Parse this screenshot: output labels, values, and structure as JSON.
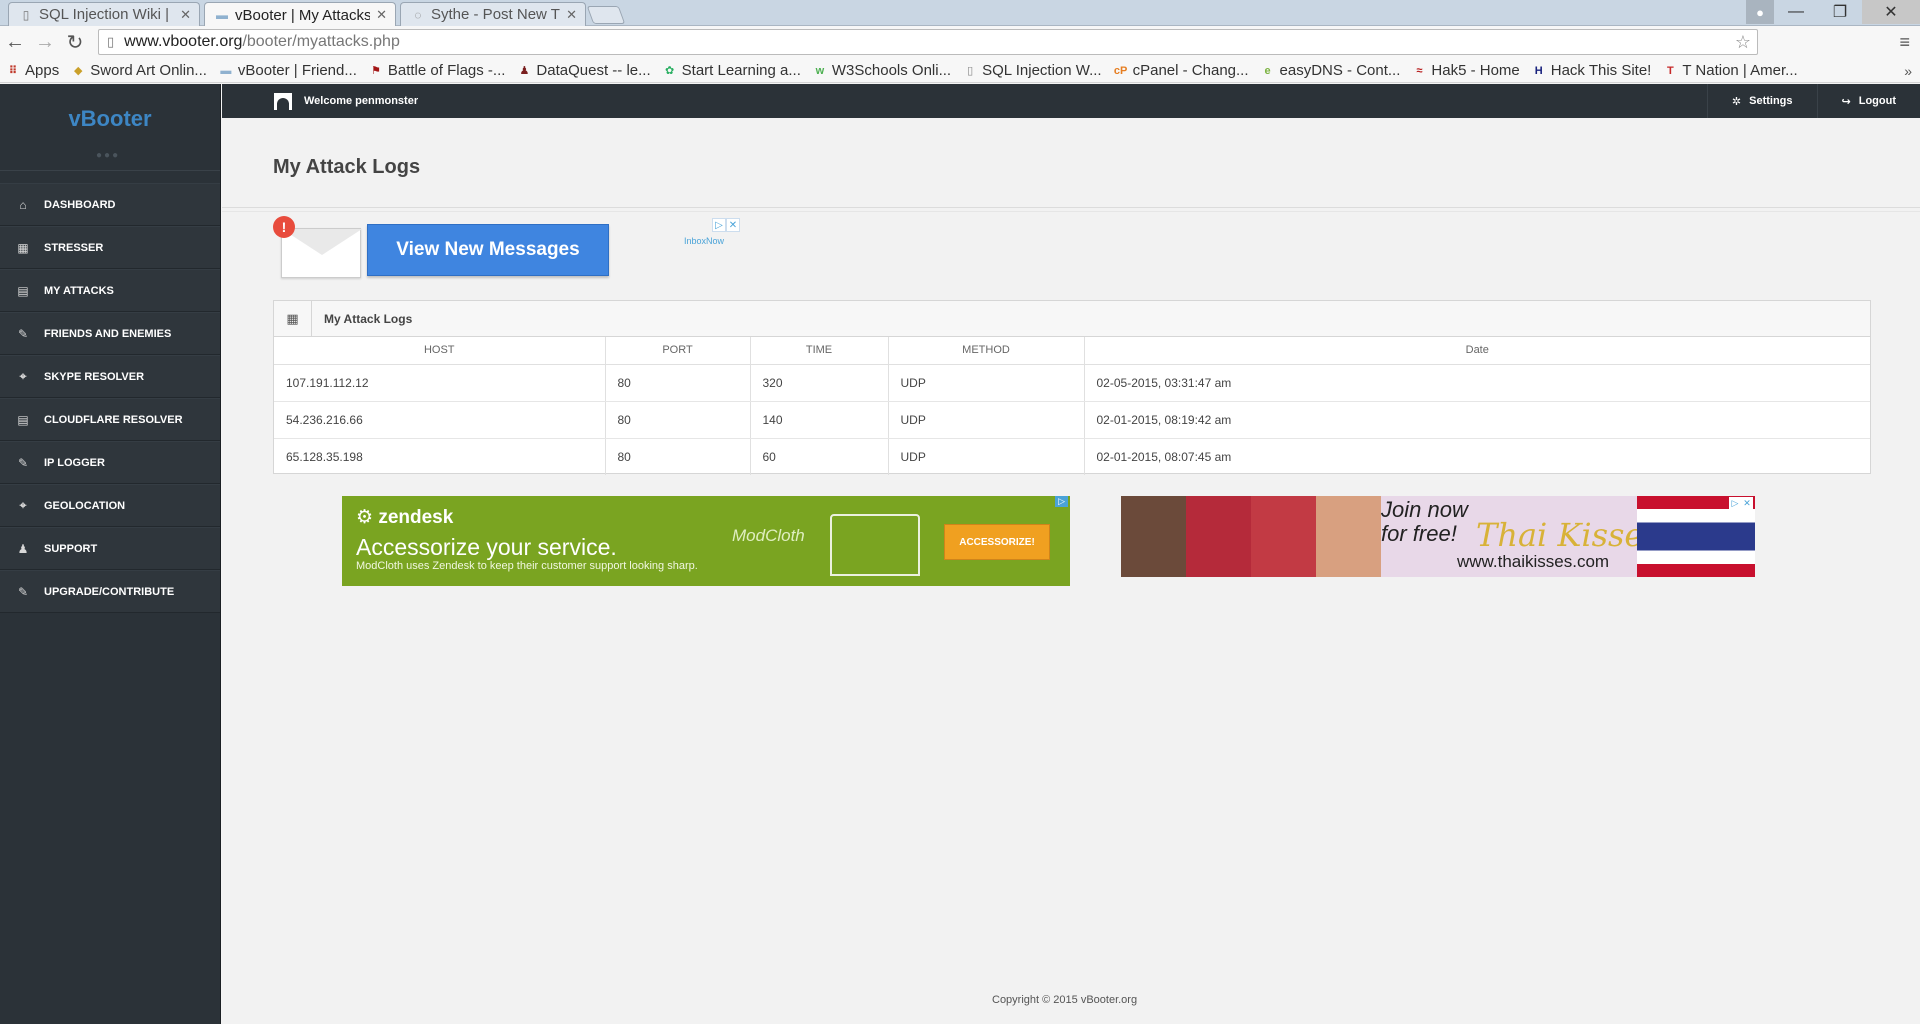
{
  "browser": {
    "tabs": [
      {
        "title": "SQL Injection Wiki | N",
        "active": false
      },
      {
        "title": "vBooter | My Attacks",
        "active": true
      },
      {
        "title": "Sythe - Post New Thr",
        "active": false
      }
    ],
    "url_host": "www.vbooter.org",
    "url_path": "/booter/myattacks.php",
    "bookmarks": [
      {
        "label": "Apps",
        "icon": "apps-grid-icon",
        "color": "#c0392b"
      },
      {
        "label": "Sword Art Onlin...",
        "icon": "sword-art-icon",
        "color": "#caa02a"
      },
      {
        "label": "vBooter | Friend...",
        "icon": "vbooter-icon",
        "color": "#8fb1cf"
      },
      {
        "label": "Battle of Flags -...",
        "icon": "flag-icon",
        "color": "#a31515"
      },
      {
        "label": "DataQuest -- le...",
        "icon": "dataquest-icon",
        "color": "#7a1f1f"
      },
      {
        "label": "Start Learning a...",
        "icon": "learning-icon",
        "color": "#27ae60"
      },
      {
        "label": "W3Schools Onli...",
        "icon": "w3schools-icon",
        "color": "#4caf50"
      },
      {
        "label": "SQL Injection W...",
        "icon": "page-icon",
        "color": "#888888"
      },
      {
        "label": "cPanel - Chang...",
        "icon": "cpanel-icon",
        "color": "#e67e22"
      },
      {
        "label": "easyDNS - Cont...",
        "icon": "easydns-icon",
        "color": "#7cb342"
      },
      {
        "label": "Hak5 - Home",
        "icon": "hak5-icon",
        "color": "#b71c1c"
      },
      {
        "label": "Hack This Site!",
        "icon": "hackthissite-icon",
        "color": "#1a237e"
      },
      {
        "label": "T Nation | Amer...",
        "icon": "tnation-icon",
        "color": "#c62828"
      }
    ]
  },
  "brand": "vBooter",
  "nav": [
    {
      "label": "DASHBOARD",
      "icon": "home-icon"
    },
    {
      "label": "STRESSER",
      "icon": "grid-icon"
    },
    {
      "label": "MY ATTACKS",
      "icon": "list-icon"
    },
    {
      "label": "FRIENDS AND ENEMIES",
      "icon": "pencil-icon"
    },
    {
      "label": "SKYPE RESOLVER",
      "icon": "target-icon"
    },
    {
      "label": "CLOUDFLARE RESOLVER",
      "icon": "list-icon"
    },
    {
      "label": "IP LOGGER",
      "icon": "pencil-icon"
    },
    {
      "label": "GEOLOCATION",
      "icon": "target-icon"
    },
    {
      "label": "SUPPORT",
      "icon": "user-icon"
    },
    {
      "label": "UPGRADE/CONTRIBUTE",
      "icon": "pencil-icon"
    }
  ],
  "topbar": {
    "welcome": "Welcome penmonster",
    "settings": "Settings",
    "logout": "Logout"
  },
  "page_title": "My Attack Logs",
  "ad_messages": {
    "button": "View New Messages",
    "alert": "!",
    "brand": "InboxNow"
  },
  "logs": {
    "title": "My Attack Logs",
    "columns": [
      "HOST",
      "PORT",
      "TIME",
      "METHOD",
      "Date"
    ],
    "rows": [
      [
        "107.191.112.12",
        "80",
        "320",
        "UDP",
        "02-05-2015, 03:31:47 am"
      ],
      [
        "54.236.216.66",
        "80",
        "140",
        "UDP",
        "02-01-2015, 08:19:42 am"
      ],
      [
        "65.128.35.198",
        "80",
        "60",
        "UDP",
        "02-01-2015, 08:07:45 am"
      ]
    ]
  },
  "ad_zendesk": {
    "logo": "zendesk",
    "headline": "Accessorize your service.",
    "sub": "ModCloth uses Zendesk to keep their customer support looking sharp.",
    "brand": "ModCloth",
    "cta": "ACCESSORIZE!"
  },
  "ad_thai": {
    "line1": "Join now",
    "line2": "for free!",
    "logo": "Thai Kisses",
    "url": "www.thaikisses.com"
  },
  "copyright": "Copyright © 2015 vBooter.org"
}
